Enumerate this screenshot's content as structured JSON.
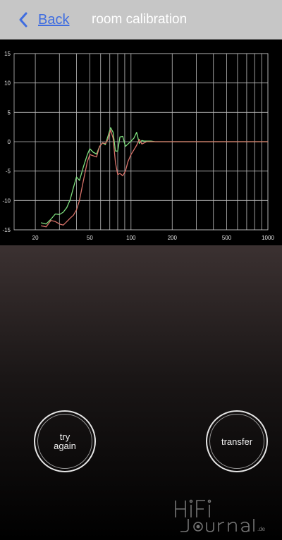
{
  "header": {
    "back_label": "Back",
    "title": "room calibration"
  },
  "chart_data": {
    "type": "line",
    "xscale": "log",
    "xlim": [
      14,
      1000
    ],
    "ylim": [
      -15,
      15
    ],
    "x_ticks": [
      20,
      50,
      100,
      200,
      500,
      1000
    ],
    "y_ticks": [
      15,
      10,
      5,
      0,
      -5,
      -10,
      -15
    ],
    "grid": true,
    "series": [
      {
        "color": "#7fe07f",
        "x": [
          22,
          24,
          26,
          28,
          30,
          32,
          34,
          36,
          38,
          40,
          42,
          45,
          48,
          50,
          53,
          56,
          59,
          62,
          65,
          68,
          71,
          74,
          77,
          80,
          83,
          87,
          91,
          95,
          100,
          105,
          110,
          115,
          120,
          125,
          130,
          140,
          150,
          170,
          200,
          250,
          300,
          400,
          500,
          700,
          1000
        ],
        "y": [
          -13.8,
          -14.0,
          -13.2,
          -12.3,
          -12.4,
          -12.0,
          -11.2,
          -9.8,
          -7.8,
          -6.0,
          -6.6,
          -4.2,
          -2.2,
          -1.2,
          -1.8,
          -2.1,
          -0.8,
          -0.2,
          -0.5,
          1.0,
          2.4,
          1.6,
          -1.6,
          -1.6,
          0.8,
          0.9,
          -0.8,
          -0.4,
          0.1,
          0.6,
          1.6,
          -0.3,
          0.2,
          0.1,
          0.1,
          0.1,
          0.0,
          0.0,
          0.0,
          0.0,
          0.0,
          0.0,
          0.0,
          0.0,
          0.0
        ]
      },
      {
        "color": "#d9736a",
        "x": [
          22,
          24,
          26,
          28,
          30,
          32,
          34,
          36,
          38,
          40,
          42,
          45,
          48,
          50,
          53,
          56,
          59,
          62,
          65,
          68,
          71,
          74,
          77,
          80,
          83,
          87,
          91,
          95,
          100,
          105,
          110,
          115,
          120,
          125,
          130,
          140,
          150,
          170,
          200,
          250,
          300,
          400,
          500,
          700,
          1000
        ],
        "y": [
          -14.3,
          -14.5,
          -13.4,
          -13.6,
          -14.0,
          -14.2,
          -13.6,
          -13.0,
          -12.5,
          -11.6,
          -10.0,
          -6.5,
          -3.4,
          -2.2,
          -2.4,
          -2.6,
          -0.8,
          -0.2,
          -0.3,
          0.4,
          2.0,
          0.6,
          -3.6,
          -5.6,
          -5.4,
          -5.8,
          -5.0,
          -3.4,
          -2.2,
          -1.4,
          -0.6,
          0.4,
          -0.4,
          -0.2,
          0.0,
          0.0,
          0.0,
          0.0,
          0.0,
          0.0,
          0.0,
          0.0,
          0.0,
          0.0,
          0.0
        ]
      }
    ]
  },
  "buttons": {
    "try_again": "try\nagain",
    "transfer": "transfer"
  },
  "watermark": {
    "text": "HiFi Journal.de"
  },
  "colors": {
    "header_bg": "#c6c6c6",
    "accent": "#3f6de0"
  }
}
